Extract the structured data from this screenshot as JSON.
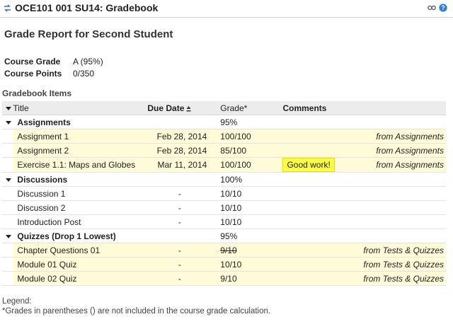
{
  "window": {
    "title": "OCE101 001 SU14: Gradebook"
  },
  "report": {
    "title": "Grade Report for Second Student",
    "course_grade_label": "Course Grade",
    "course_grade_value": "A (95%)",
    "course_points_label": "Course Points",
    "course_points_value": "0/350",
    "items_label": "Gradebook Items"
  },
  "columns": {
    "title": "Title",
    "due": "Due Date",
    "grade": "Grade*",
    "comments": "Comments"
  },
  "categories": [
    {
      "name": "Assignments",
      "grade": "95%",
      "items": [
        {
          "title": "Assignment 1",
          "due": "Feb 28, 2014",
          "grade": "100/100",
          "comment": "",
          "from": "from Assignments"
        },
        {
          "title": "Assignment 2",
          "due": "Feb 28, 2014",
          "grade": "85/100",
          "comment": "",
          "from": "from Assignments"
        },
        {
          "title": "Exercise 1.1: Maps and Globes",
          "due": "Mar 11, 2014",
          "grade": "100/100",
          "comment": "Good work!",
          "from": "from Assignments"
        }
      ]
    },
    {
      "name": "Discussions",
      "grade": "100%",
      "items": [
        {
          "title": "Discussion 1",
          "due": "-",
          "grade": "10/10",
          "comment": "",
          "from": ""
        },
        {
          "title": "Discussion 2",
          "due": "-",
          "grade": "10/10",
          "comment": "",
          "from": ""
        },
        {
          "title": "Introduction Post",
          "due": "-",
          "grade": "10/10",
          "comment": "",
          "from": ""
        }
      ]
    },
    {
      "name": "Quizzes (Drop 1 Lowest)",
      "grade": "95%",
      "items": [
        {
          "title": "Chapter Questions 01",
          "due": "-",
          "grade": "9/10",
          "comment": "",
          "from": "from Tests & Quizzes",
          "dropped": true
        },
        {
          "title": "Module 01 Quiz",
          "due": "-",
          "grade": "10/10",
          "comment": "",
          "from": "from Tests & Quizzes"
        },
        {
          "title": "Module 02 Quiz",
          "due": "-",
          "grade": "9/10",
          "comment": "",
          "from": "from Tests & Quizzes"
        }
      ]
    }
  ],
  "legend": {
    "title": "Legend:",
    "note": "*Grades in parentheses () are not included in the course grade calculation."
  },
  "icons": {
    "app": "swap-arrows-icon",
    "link": "link-icon",
    "help": "help-icon"
  },
  "colors": {
    "highlight_row": "#fffbd8",
    "comment_badge": "#ffff44",
    "header_bg": "#ececec",
    "help_blue": "#2f7fd8"
  }
}
